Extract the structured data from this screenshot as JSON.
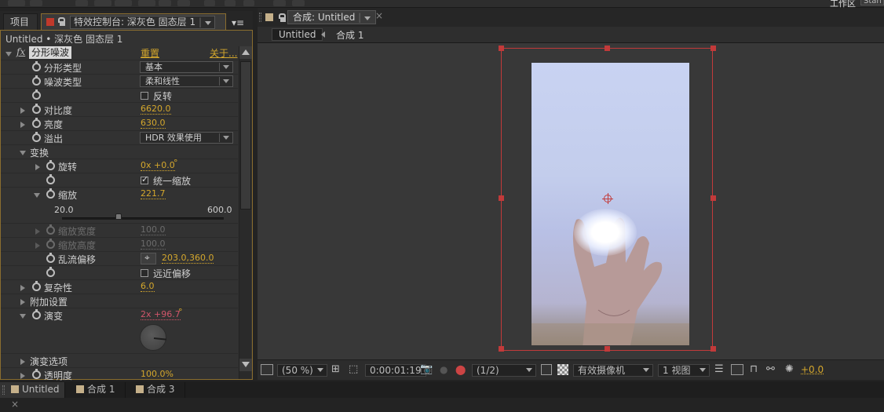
{
  "toolbar": {
    "workspace_label": "工作区",
    "workspace_value": "Stan"
  },
  "left_panel": {
    "tabs": [
      {
        "label": "项目"
      },
      {
        "label": "特效控制台: 深灰色 固态层 1"
      }
    ],
    "layer_path": "Untitled • 深灰色 固态层 1",
    "effect": {
      "fx_badge": "fx",
      "name": "分形噪波",
      "reset_label": "重置",
      "about_label": "关于..."
    },
    "properties": [
      {
        "label": "分形类型",
        "type": "select",
        "value": "基本"
      },
      {
        "label": "噪波类型",
        "type": "select",
        "value": "柔和线性"
      },
      {
        "label": "",
        "type": "checkbox",
        "checked": false,
        "checkbox_label": "反转"
      },
      {
        "label": "对比度",
        "type": "number",
        "value": "6620.0"
      },
      {
        "label": "亮度",
        "type": "number",
        "value": "630.0"
      },
      {
        "label": "溢出",
        "type": "select",
        "value": "HDR 效果使用"
      },
      {
        "label": "变换",
        "type": "group"
      },
      {
        "label": "旋转",
        "type": "angle",
        "value": "0x +0.0",
        "unit": "°"
      },
      {
        "label": "",
        "type": "checkbox",
        "checked": true,
        "checkbox_label": "统一缩放"
      },
      {
        "label": "缩放",
        "type": "number",
        "value": "221.7",
        "slider_min": "20.0",
        "slider_max": "600.0",
        "slider_fraction": 0.348
      },
      {
        "label": "缩放宽度",
        "type": "number",
        "value": "100.0",
        "disabled": true
      },
      {
        "label": "缩放高度",
        "type": "number",
        "value": "100.0",
        "disabled": true
      },
      {
        "label": "乱流偏移",
        "type": "point",
        "value": "203.0,360.0"
      },
      {
        "label": "",
        "type": "checkbox",
        "checked": false,
        "checkbox_label": "远近偏移"
      },
      {
        "label": "复杂性",
        "type": "number",
        "value": "6.0"
      },
      {
        "label": "附加设置",
        "type": "group"
      },
      {
        "label": "演变",
        "type": "angle",
        "value": "2x +96.7",
        "unit": "°",
        "keyframed": true
      },
      {
        "label": "演变选项",
        "type": "group"
      },
      {
        "label": "透明度",
        "type": "number",
        "value": "100.0%"
      }
    ]
  },
  "comp_panel": {
    "tab_label": "合成: Untitled",
    "breadcrumb": [
      "Untitled",
      "合成 1"
    ],
    "viewer_bar": {
      "zoom": "(50 %)",
      "timecode": "0:00:01:19",
      "resolution": "(1/2)",
      "camera": "有效摄像机",
      "views": "1 视图",
      "exposure": "+0.0"
    }
  },
  "bottom_tabs": [
    {
      "label": "Untitled",
      "active": true,
      "closable": true
    },
    {
      "label": "合成 1",
      "active": false
    },
    {
      "label": "合成 3",
      "active": false
    }
  ],
  "colors": {
    "accent_orange": "#d4a72c",
    "keyframe_red": "#d0556a",
    "bbox_red": "#c23a3a",
    "panel_border": "#8a6d2f"
  }
}
